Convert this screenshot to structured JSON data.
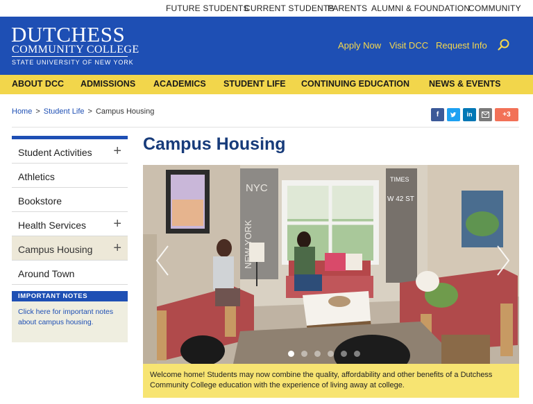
{
  "utility_nav": [
    "FUTURE STUDENTS",
    "CURRENT STUDENTS",
    "PARENTS",
    "ALUMNI & FOUNDATION",
    "COMMUNITY"
  ],
  "logo": {
    "line1": "DUTCHESS",
    "line2": "COMMUNITY COLLEGE",
    "line3": "STATE UNIVERSITY OF NEW YORK"
  },
  "header_links": [
    "Apply Now",
    "Visit DCC",
    "Request Info"
  ],
  "main_nav": [
    "ABOUT DCC",
    "ADMISSIONS",
    "ACADEMICS",
    "STUDENT LIFE",
    "CONTINUING EDUCATION",
    "NEWS & EVENTS"
  ],
  "breadcrumb": [
    "Home",
    "Student Life",
    "Campus Housing"
  ],
  "share": {
    "count": "+3",
    "colors": {
      "facebook": "#3b5998",
      "twitter": "#1da1f2",
      "linkedin": "#0077b5",
      "email": "#7a7a7a",
      "more": "#f27157"
    }
  },
  "sidebar": {
    "items": [
      {
        "label": "Student Activities",
        "expandable": true
      },
      {
        "label": "Athletics",
        "expandable": false
      },
      {
        "label": "Bookstore",
        "expandable": false
      },
      {
        "label": "Health Services",
        "expandable": true
      },
      {
        "label": "Campus Housing",
        "expandable": true,
        "active": true
      },
      {
        "label": "Around Town",
        "expandable": false
      }
    ],
    "plus_symbol": "+"
  },
  "important_notes": {
    "heading": "IMPORTANT NOTES",
    "text": "Click here for important notes about campus housing."
  },
  "page_title": "Campus Housing",
  "carousel": {
    "slides": 6,
    "active_slide": 1,
    "prev_icon": "chevron-left-icon",
    "next_icon": "chevron-right-icon",
    "poster_text": [
      "NYC",
      "NEW YORK",
      "W 42 ST",
      "TIMES"
    ]
  },
  "caption": "Welcome home! Students may now combine the quality, affordability and other benefits of a Dutchess Community College education with the experience of living away at college.",
  "colors": {
    "brand_blue": "#1e4fb4",
    "nav_yellow": "#f2d64b",
    "link_yellow": "#f7d94c",
    "title_navy": "#173b7a",
    "caption_yellow": "#f7e472"
  }
}
